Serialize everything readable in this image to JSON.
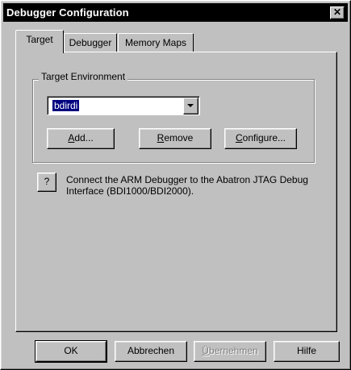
{
  "window": {
    "title": "Debugger Configuration",
    "close_glyph": "✕"
  },
  "tabs": [
    {
      "label": "Target",
      "active": true
    },
    {
      "label": "Debugger",
      "active": false
    },
    {
      "label": "Memory Maps",
      "active": false
    }
  ],
  "target_environment": {
    "group_label": "Target Environment",
    "selected": "bdirdi",
    "buttons": {
      "add": {
        "u": "A",
        "rest": "dd..."
      },
      "remove": {
        "u": "R",
        "rest": "emove"
      },
      "configure": {
        "u": "C",
        "rest": "onfigure..."
      }
    }
  },
  "help": {
    "button": "?",
    "description": "Connect the ARM Debugger to the Abatron JTAG Debug Interface (BDI1000/BDI2000)."
  },
  "footer": {
    "ok": "OK",
    "cancel": "Abbrechen",
    "apply": {
      "u": "Ü",
      "rest": "bernehmen"
    },
    "help": "Hilfe"
  }
}
